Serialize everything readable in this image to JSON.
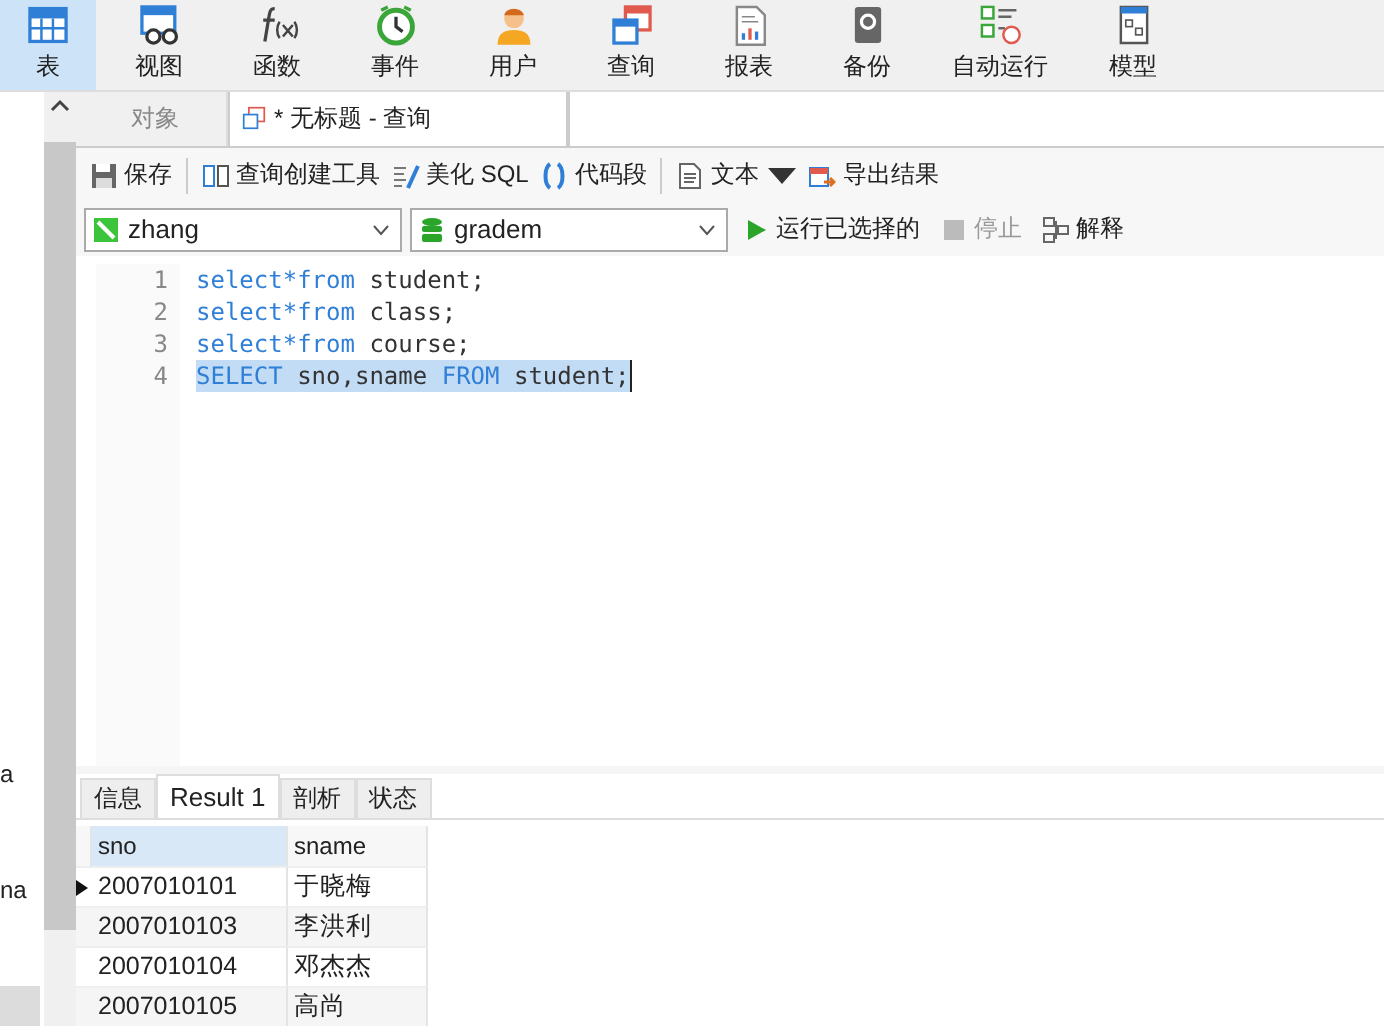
{
  "ribbon": [
    {
      "label": "表",
      "selected": true
    },
    {
      "label": "视图",
      "selected": false
    },
    {
      "label": "函数",
      "selected": false
    },
    {
      "label": "事件",
      "selected": false
    },
    {
      "label": "用户",
      "selected": false
    },
    {
      "label": "查询",
      "selected": false
    },
    {
      "label": "报表",
      "selected": false
    },
    {
      "label": "备份",
      "selected": false
    },
    {
      "label": "自动运行",
      "selected": false
    },
    {
      "label": "模型",
      "selected": false
    }
  ],
  "sidebar": {
    "texts": [
      "a",
      "na"
    ]
  },
  "tabs": [
    {
      "label": "对象",
      "selected": false
    },
    {
      "label": "* 无标题 - 查询",
      "selected": true
    }
  ],
  "toolbar": [
    "保存",
    "查询创建工具",
    "美化 SQL",
    "代码段",
    "文本",
    "导出结果"
  ],
  "connection": {
    "value": "zhang"
  },
  "database": {
    "value": "gradem"
  },
  "run_bar": [
    {
      "label": "运行已选择的",
      "disabled": false
    },
    {
      "label": "停止",
      "disabled": true
    },
    {
      "label": "解释",
      "disabled": false
    }
  ],
  "editor": {
    "lines": [
      {
        "number": "1",
        "selected": false,
        "tokens": [
          {
            "text": "select*from",
            "kind": "keyword"
          },
          {
            "text": " student;",
            "kind": "plain"
          }
        ]
      },
      {
        "number": "2",
        "selected": false,
        "tokens": [
          {
            "text": "select*from",
            "kind": "keyword"
          },
          {
            "text": " class;",
            "kind": "plain"
          }
        ]
      },
      {
        "number": "3",
        "selected": false,
        "tokens": [
          {
            "text": "select*from",
            "kind": "keyword"
          },
          {
            "text": " course;",
            "kind": "plain"
          }
        ]
      },
      {
        "number": "4",
        "selected": true,
        "tokens": [
          {
            "text": "SELECT",
            "kind": "keyword"
          },
          {
            "text": " sno,sname ",
            "kind": "plain"
          },
          {
            "text": "FROM",
            "kind": "keyword"
          },
          {
            "text": " student;",
            "kind": "plain"
          }
        ]
      }
    ]
  },
  "result_tabs": [
    {
      "label": "信息",
      "selected": false
    },
    {
      "label": "Result 1",
      "selected": true
    },
    {
      "label": "剖析",
      "selected": false
    },
    {
      "label": "状态",
      "selected": false
    }
  ],
  "table": {
    "columns": [
      {
        "label": "sno",
        "selected": true
      },
      {
        "label": "sname",
        "selected": false
      }
    ],
    "rows": [
      {
        "selected": true,
        "cells": [
          "2007010101",
          "于晓梅"
        ]
      },
      {
        "selected": false,
        "cells": [
          "2007010103",
          "李洪利"
        ]
      },
      {
        "selected": false,
        "cells": [
          "2007010104",
          "邓杰杰"
        ]
      },
      {
        "selected": false,
        "cells": [
          "2007010105",
          "高尚"
        ]
      }
    ]
  }
}
